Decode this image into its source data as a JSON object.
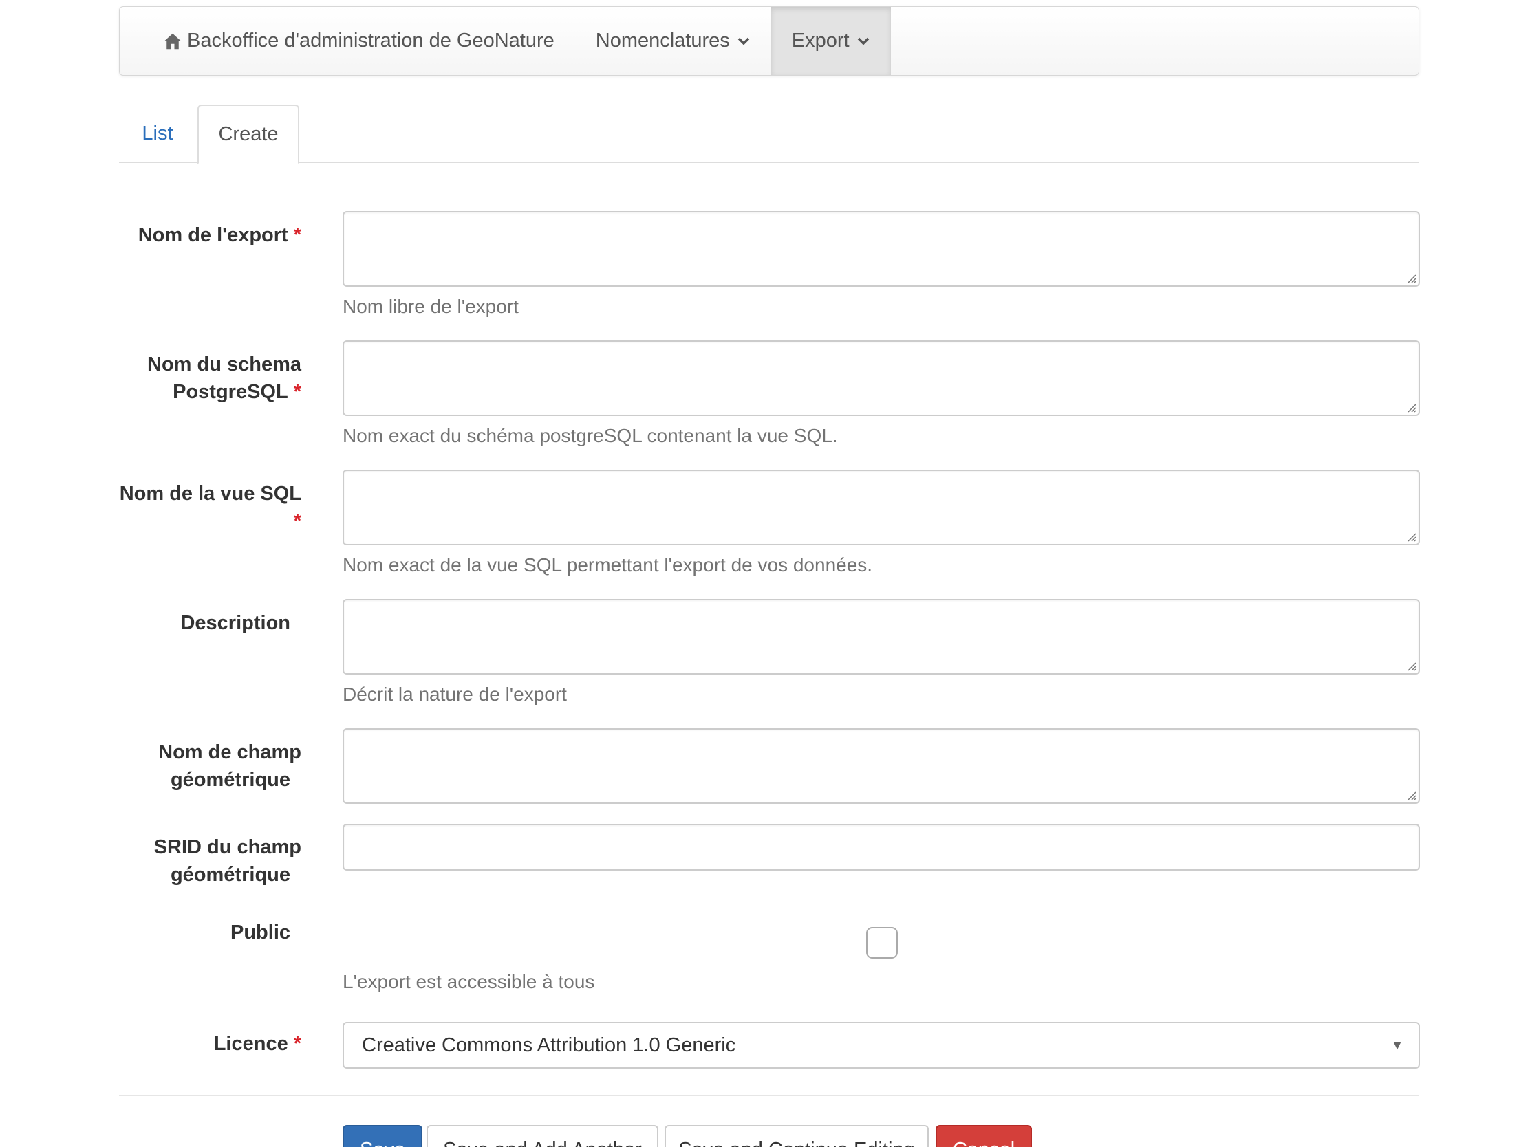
{
  "navbar": {
    "brand": "Backoffice d'administration de GeoNature",
    "brand_icon": "home-icon",
    "items": [
      {
        "label": "Nomenclatures",
        "icon": "chevron-down-icon",
        "active": false
      },
      {
        "label": "Export",
        "icon": "chevron-down-icon",
        "active": true
      }
    ]
  },
  "tabs": [
    {
      "label": "List",
      "active": false
    },
    {
      "label": "Create",
      "active": true
    }
  ],
  "form": {
    "required_marker": "*",
    "fields": {
      "nom_export": {
        "label": "Nom de l'export",
        "required": true,
        "value": "",
        "help": "Nom libre de l'export"
      },
      "schema": {
        "label_line1": "Nom du schema",
        "label_line2": "PostgreSQL",
        "required": true,
        "value": "",
        "help": "Nom exact du schéma postgreSQL contenant la vue SQL."
      },
      "vue_sql": {
        "label": "Nom de la vue SQL",
        "required": true,
        "value": "",
        "help": "Nom exact de la vue SQL permettant l'export de vos données."
      },
      "description": {
        "label": "Description",
        "required": false,
        "value": "",
        "help": "Décrit la nature de l'export"
      },
      "geom_field": {
        "label_line1": "Nom de champ",
        "label_line2": "géométrique",
        "required": false,
        "value": ""
      },
      "srid": {
        "label_line1": "SRID du champ",
        "label_line2": "géométrique",
        "required": false,
        "value": ""
      },
      "public": {
        "label": "Public",
        "checked": false,
        "help": "L'export est accessible à tous"
      },
      "licence": {
        "label": "Licence",
        "required": true,
        "selected": "Creative Commons Attribution 1.0 Generic"
      }
    }
  },
  "buttons": {
    "save": "Save",
    "save_add": "Save and Add Another",
    "save_continue": "Save and Continue Editing",
    "cancel": "Cancel"
  },
  "colors": {
    "link": "#2a6ebb",
    "required": "#d9232a",
    "primary": "#3370b7",
    "danger": "#d43f3a"
  }
}
